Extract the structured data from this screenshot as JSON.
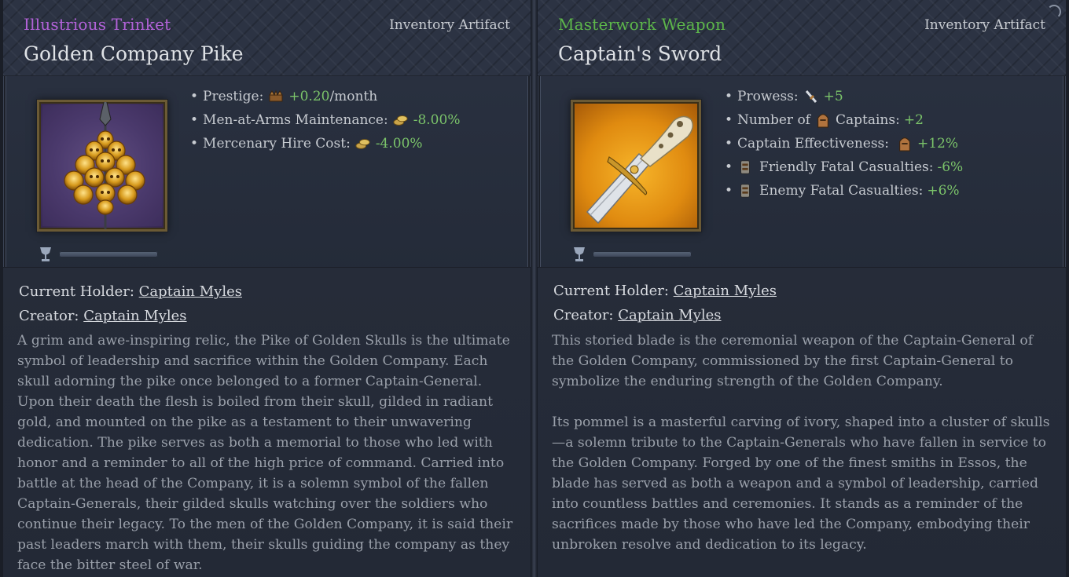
{
  "colors": {
    "rarity_illustrious": "#b262d8",
    "rarity_masterwork": "#5db74a",
    "positive_value": "#7bc46a",
    "body_text": "#9aa0aa",
    "heading_text": "#dfe2e6"
  },
  "cards": [
    {
      "rarity": "Illustrious Trinket",
      "rarity_color": "#b262d8",
      "artifact_type": "Inventory Artifact",
      "name": "Golden Company Pike",
      "icon": "golden-pike-icon",
      "modifiers": [
        {
          "label": "Prestige:",
          "icon": "crown-icon",
          "value": "+0.20",
          "suffix": "/month"
        },
        {
          "label": "Men-at-Arms Maintenance:",
          "icon": "gold-coins-icon",
          "value": "-8.00%",
          "suffix": ""
        },
        {
          "label": "Mercenary Hire Cost:",
          "icon": "gold-coins-icon",
          "value": "-4.00%",
          "suffix": ""
        }
      ],
      "quality_icon": "goblet-icon",
      "holder_label": "Current Holder:",
      "holder": "Captain Myles",
      "creator_label": "Creator:",
      "creator": "Captain Myles",
      "description": [
        "A grim and awe-inspiring relic, the Pike of Golden Skulls is the ultimate symbol of leadership and sacrifice within the Golden Company. Each skull adorning the pike once belonged to a former Captain-General. Upon their death the flesh is boiled from their skull, gilded in radiant gold, and mounted on the pike as a testament to their unwavering dedication. The pike serves as both a memorial to those who led with honor and a reminder to all of the high price of command. Carried into battle at the head of the Company, it is a solemn symbol of the fallen Captain-Generals, their gilded skulls watching over the soldiers who continue their legacy. To the men of the Golden Company, it is said their past leaders march with them, their skulls guiding the company as they face the bitter steel of war."
      ]
    },
    {
      "rarity": "Masterwork Weapon",
      "rarity_color": "#5db74a",
      "artifact_type": "Inventory Artifact",
      "name": "Captain's Sword",
      "icon": "captains-sword-icon",
      "modifiers": [
        {
          "prefix": "Prowess:",
          "icon": "prowess-icon",
          "value": "+5"
        },
        {
          "prefix": "Number of",
          "icon": "captain-helmet-icon",
          "mid": "Captains:",
          "value": "+2"
        },
        {
          "prefix": "Captain Effectiveness:",
          "icon": "captain-helmet-icon",
          "value": "+12%"
        },
        {
          "lead_icon": "casualty-icon",
          "prefix": "Friendly Fatal Casualties:",
          "value": "-6%"
        },
        {
          "lead_icon": "casualty-icon",
          "prefix": "Enemy Fatal Casualties:",
          "value": "+6%"
        }
      ],
      "quality_icon": "goblet-icon",
      "holder_label": "Current Holder:",
      "holder": "Captain Myles",
      "creator_label": "Creator:",
      "creator": "Captain Myles",
      "description": [
        "This storied blade is the ceremonial weapon of the Captain-General of the Golden Company, commissioned by the first Captain-General to symbolize the enduring strength of the Golden Company.",
        "Its pommel is a masterful carving of ivory, shaped into a cluster of skulls—a solemn tribute to the Captain-Generals who have fallen in service to the Golden Company. Forged by one of the finest smiths in Essos, the blade has served as both a weapon and a symbol of leadership, carried into countless battles and ceremonies. It stands as a reminder of the sacrifices made by those who have led the Company, embodying their unbroken resolve and dedication to its legacy."
      ]
    }
  ]
}
